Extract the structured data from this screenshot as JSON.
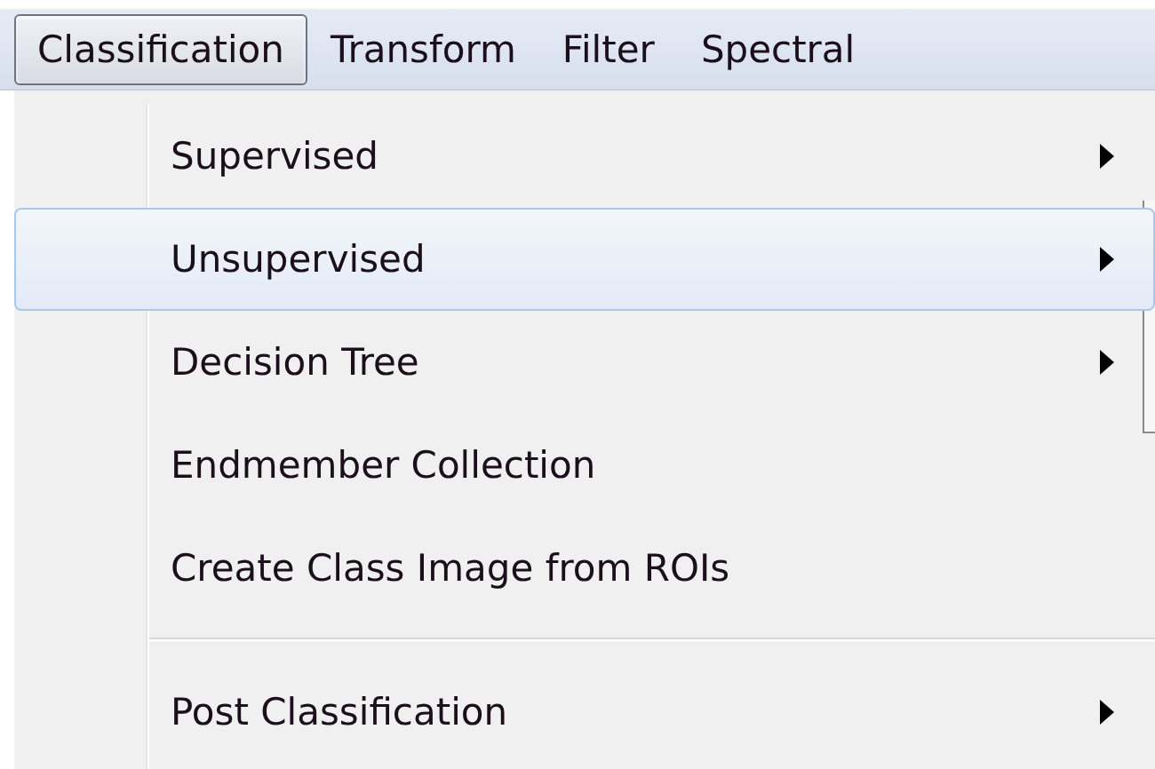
{
  "menu_bar": [
    {
      "label": "Classification",
      "selected": true
    },
    {
      "label": "Transform",
      "selected": false
    },
    {
      "label": "Filter",
      "selected": false
    },
    {
      "label": "Spectral",
      "selected": false
    }
  ],
  "menu": {
    "items": [
      {
        "kind": "submenu",
        "label": "Supervised",
        "selected": false
      },
      {
        "kind": "submenu",
        "label": "Unsupervised",
        "selected": true
      },
      {
        "kind": "submenu",
        "label": "Decision Tree",
        "selected": false
      },
      {
        "kind": "command",
        "label": "Endmember Collection",
        "selected": false
      },
      {
        "kind": "command",
        "label": "Create Class Image from ROIs",
        "selected": false
      },
      {
        "kind": "separator"
      },
      {
        "kind": "submenu",
        "label": "Post Classification",
        "selected": false
      }
    ]
  }
}
